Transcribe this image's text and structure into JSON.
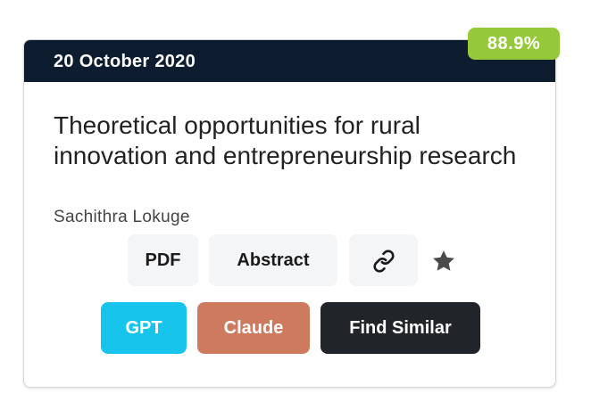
{
  "card": {
    "date": "20 October 2020",
    "score": "88.9%",
    "title": "Theoretical opportunities for rural innovation and entrepreneurship research",
    "author": "Sachithra Lokuge"
  },
  "actions": {
    "pdf_label": "PDF",
    "abstract_label": "Abstract",
    "link_icon": "link-icon",
    "star_icon": "star-icon"
  },
  "ai_actions": {
    "gpt_label": "GPT",
    "claude_label": "Claude",
    "find_similar_label": "Find Similar"
  },
  "colors": {
    "header_bg": "#0e1c2f",
    "score_badge": "#96c93a",
    "gpt": "#17c5ec",
    "claude": "#cd7a5e",
    "find_similar": "#212529",
    "light_button": "#f4f5f7"
  }
}
